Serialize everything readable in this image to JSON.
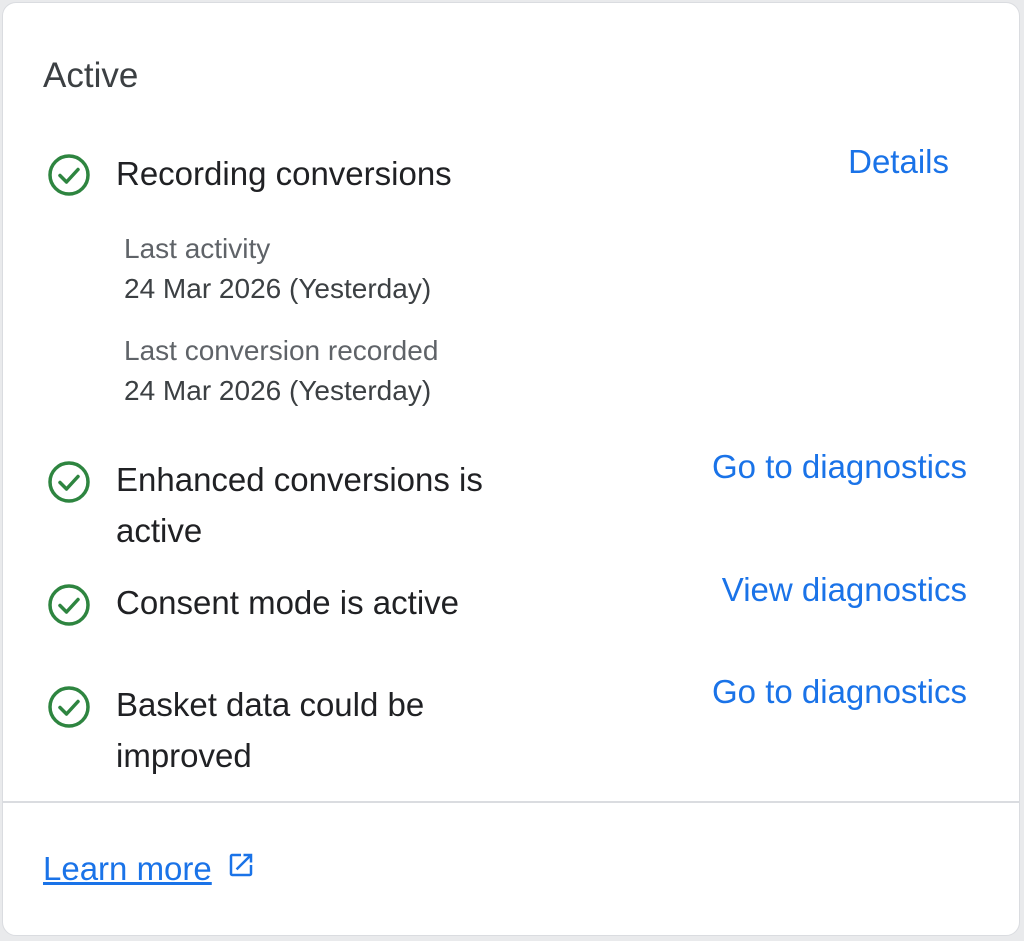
{
  "panel": {
    "title": "Active",
    "accent_color": "#1a73e8",
    "success_color": "#2e8540"
  },
  "rows": [
    {
      "icon": "check-circle-icon",
      "label": "Recording conversions",
      "link": "Details",
      "meta": [
        {
          "label": "Last activity",
          "value": "24 Mar 2026 (Yesterday)"
        },
        {
          "label": "Last conversion recorded",
          "value": "24 Mar 2026 (Yesterday)"
        }
      ]
    },
    {
      "icon": "check-circle-icon",
      "label_line1": "Enhanced conversions is",
      "label_line2": "active",
      "link": "Go to diagnostics"
    },
    {
      "icon": "check-circle-icon",
      "label": "Consent mode is active",
      "link": "View diagnostics"
    },
    {
      "icon": "check-circle-icon",
      "label_line1": "Basket data could be",
      "label_line2": "improved",
      "link": "Go to diagnostics"
    }
  ],
  "footer": {
    "learn_more": "Learn more",
    "icon": "open-in-new-icon"
  }
}
